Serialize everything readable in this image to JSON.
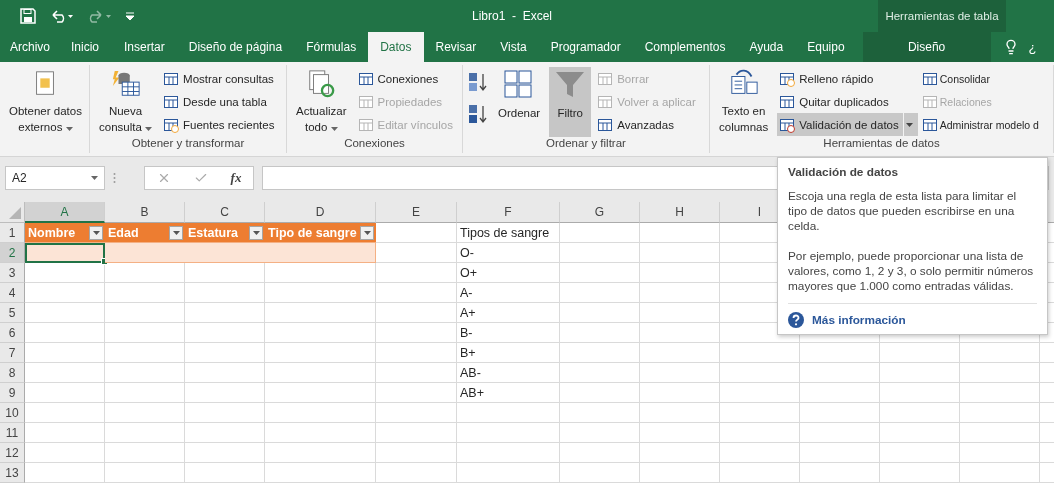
{
  "window": {
    "title": "Libro1  -  Excel",
    "context_title": "Herramientas de tabla"
  },
  "ribbon_tabs": [
    {
      "label": "Archivo",
      "selected": false,
      "kind": "normal"
    },
    {
      "label": "Inicio",
      "selected": false,
      "kind": "normal"
    },
    {
      "label": "Insertar",
      "selected": false,
      "kind": "normal"
    },
    {
      "label": "Diseño de página",
      "selected": false,
      "kind": "normal"
    },
    {
      "label": "Fórmulas",
      "selected": false,
      "kind": "normal"
    },
    {
      "label": "Datos",
      "selected": true,
      "kind": "normal"
    },
    {
      "label": "Revisar",
      "selected": false,
      "kind": "normal"
    },
    {
      "label": "Vista",
      "selected": false,
      "kind": "normal"
    },
    {
      "label": "Programador",
      "selected": false,
      "kind": "normal"
    },
    {
      "label": "Complementos",
      "selected": false,
      "kind": "normal"
    },
    {
      "label": "Ayuda",
      "selected": false,
      "kind": "normal"
    },
    {
      "label": "Equipo",
      "selected": false,
      "kind": "normal"
    },
    {
      "label": "Diseño",
      "selected": false,
      "kind": "contextual"
    }
  ],
  "ribbon_groups": [
    {
      "items": [
        {
          "kind": "large",
          "lines": [
            "Obtener datos",
            "externos"
          ],
          "dropdown": true,
          "selected": false
        }
      ]
    },
    {
      "label": "Obtener y transformar",
      "items": [
        {
          "kind": "large",
          "lines": [
            "Nueva",
            "consulta"
          ],
          "dropdown": true,
          "selected": false
        },
        {
          "kind": "stack",
          "entries": [
            {
              "label": "Mostrar consultas",
              "disabled": false,
              "selected": false,
              "dropdown": false
            },
            {
              "label": "Desde una tabla",
              "disabled": false,
              "selected": false,
              "dropdown": false
            },
            {
              "label": "Fuentes recientes",
              "disabled": false,
              "selected": false,
              "dropdown": false
            }
          ]
        }
      ]
    },
    {
      "label": "Conexiones",
      "items": [
        {
          "kind": "large",
          "lines": [
            "Actualizar",
            "todo"
          ],
          "dropdown": true,
          "selected": false
        },
        {
          "kind": "stack",
          "entries": [
            {
              "label": "Conexiones",
              "disabled": false,
              "selected": false,
              "dropdown": false
            },
            {
              "label": "Propiedades",
              "disabled": true,
              "selected": false,
              "dropdown": false
            },
            {
              "label": "Editar vínculos",
              "disabled": true,
              "selected": false,
              "dropdown": false
            }
          ]
        }
      ]
    },
    {
      "label": "Ordenar y filtrar",
      "items": [
        {
          "kind": "icon_stack"
        },
        {
          "kind": "large",
          "lines": [
            "Ordenar"
          ],
          "dropdown": false,
          "selected": false
        },
        {
          "kind": "large",
          "lines": [
            "Filtro"
          ],
          "dropdown": false,
          "selected": true
        },
        {
          "kind": "stack",
          "entries": [
            {
              "label": "Borrar",
              "disabled": true,
              "selected": false,
              "dropdown": false
            },
            {
              "label": "Volver a aplicar",
              "disabled": true,
              "selected": false,
              "dropdown": false
            },
            {
              "label": "Avanzadas",
              "disabled": false,
              "selected": false,
              "dropdown": false
            }
          ]
        }
      ]
    },
    {
      "label": "Herramientas de datos",
      "items": [
        {
          "kind": "large",
          "lines": [
            "Texto en",
            "columnas"
          ],
          "dropdown": false,
          "selected": false
        },
        {
          "kind": "stack",
          "entries": [
            {
              "label": "Relleno rápido",
              "disabled": false,
              "selected": false,
              "dropdown": false
            },
            {
              "label": "Quitar duplicados",
              "disabled": false,
              "selected": false,
              "dropdown": false
            },
            {
              "label": "Validación de datos",
              "disabled": false,
              "selected": true,
              "dropdown": true
            }
          ]
        },
        {
          "kind": "stack",
          "entries": [
            {
              "label": "Consolidar",
              "disabled": false,
              "selected": false,
              "dropdown": false
            },
            {
              "label": "Relaciones",
              "disabled": true,
              "selected": false,
              "dropdown": false
            },
            {
              "label": "Administrar modelo d",
              "disabled": false,
              "selected": false,
              "dropdown": false
            }
          ]
        }
      ]
    }
  ],
  "formula_bar": {
    "name_box": "A2",
    "function_button": "fx"
  },
  "grid": {
    "columns": [
      {
        "label": "A",
        "selected": true
      },
      {
        "label": "B",
        "selected": false
      },
      {
        "label": "C",
        "selected": false
      },
      {
        "label": "D",
        "selected": false
      },
      {
        "label": "E",
        "selected": false
      },
      {
        "label": "F",
        "selected": false
      },
      {
        "label": "G",
        "selected": false
      },
      {
        "label": "H",
        "selected": false
      },
      {
        "label": "I",
        "selected": false
      }
    ],
    "rows": [
      {
        "label": "1",
        "selected": false
      },
      {
        "label": "2",
        "selected": true
      },
      {
        "label": "3",
        "selected": false
      },
      {
        "label": "4",
        "selected": false
      },
      {
        "label": "5",
        "selected": false
      },
      {
        "label": "6",
        "selected": false
      },
      {
        "label": "7",
        "selected": false
      },
      {
        "label": "8",
        "selected": false
      },
      {
        "label": "9",
        "selected": false
      },
      {
        "label": "10",
        "selected": false
      },
      {
        "label": "11",
        "selected": false
      },
      {
        "label": "12",
        "selected": false
      },
      {
        "label": "13",
        "selected": false
      }
    ]
  },
  "table": {
    "headers": [
      "Nombre",
      "Edad",
      "Estatura",
      "Tipo de sangre"
    ]
  },
  "list": {
    "cells": [
      "Tipos de sangre",
      "O-",
      "O+",
      "A-",
      "A+",
      "B-",
      "B+",
      "AB-",
      "AB+"
    ]
  },
  "tooltip": {
    "title": "Validación de datos",
    "paragraphs": [
      "Escoja una regla de esta lista para limitar el tipo de datos que pueden escribirse en una celda.",
      "Por ejemplo, puede proporcionar una lista de valores, como 1, 2 y 3, o solo permitir números mayores que 1.000 como entradas válidas."
    ],
    "link": "Más información"
  },
  "help_search": "¿"
}
